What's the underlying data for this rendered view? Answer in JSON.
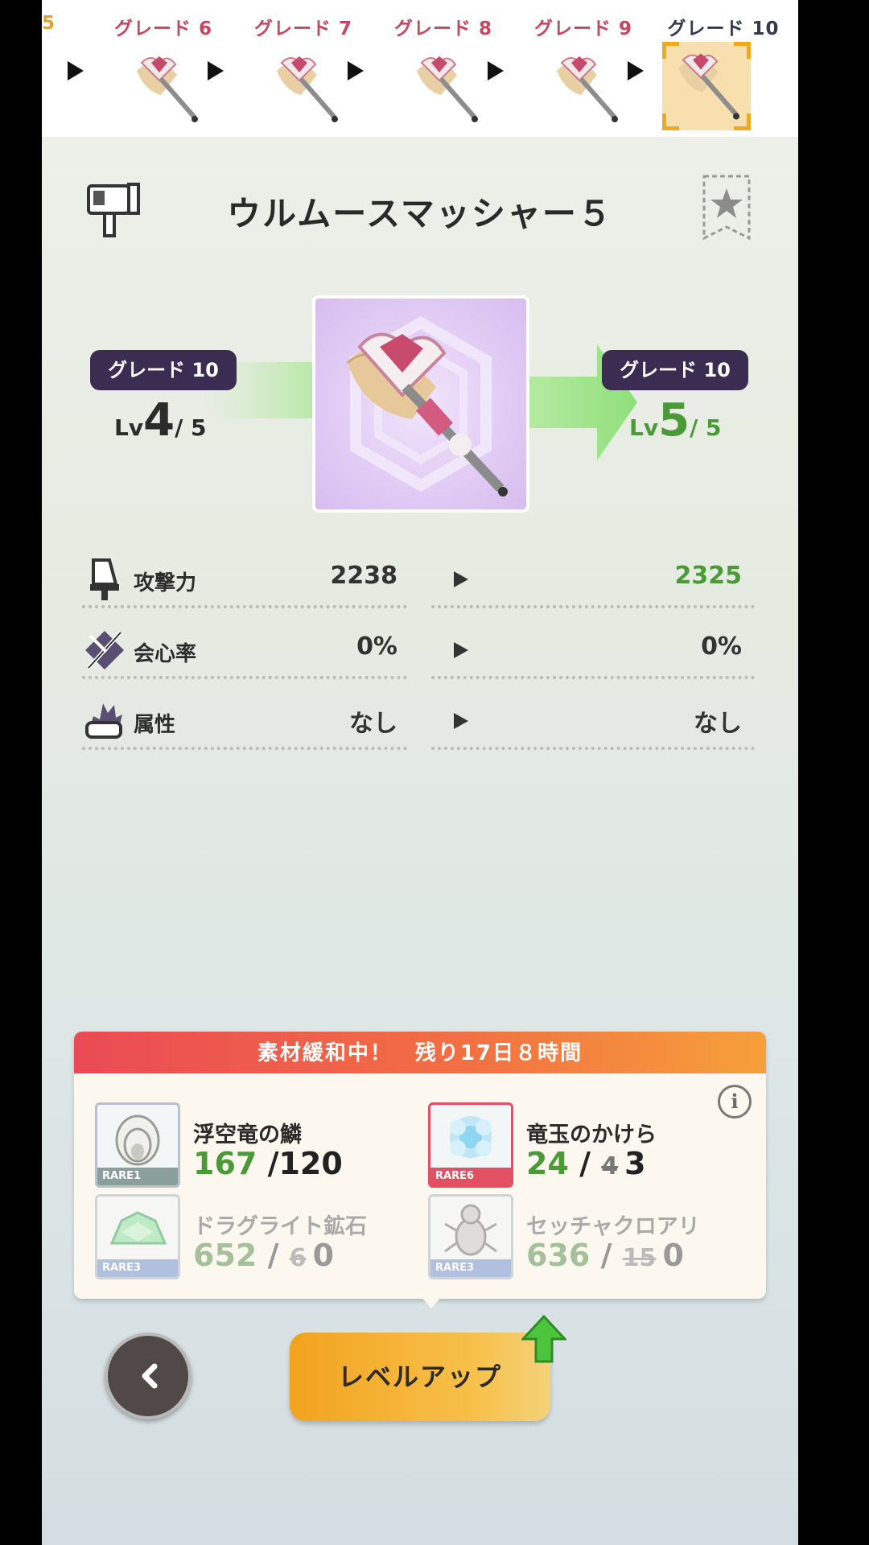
{
  "grade_strip": {
    "partial_label": "5",
    "items": [
      {
        "label": "グレード 6"
      },
      {
        "label": "グレード 7"
      },
      {
        "label": "グレード 8"
      },
      {
        "label": "グレード 9"
      },
      {
        "label": "グレード 10",
        "selected": true
      }
    ]
  },
  "weapon": {
    "name": "ウルムースマッシャー５"
  },
  "level": {
    "current": {
      "grade": "グレード 10",
      "lv_prefix": "Lv",
      "lv": "4",
      "lv_max": "/ 5"
    },
    "next": {
      "grade": "グレード 10",
      "lv_prefix": "Lv",
      "lv": "5",
      "lv_max": "/ 5"
    }
  },
  "stats": [
    {
      "label": "攻撃力",
      "current": "2238",
      "next": "2325",
      "icon": "sword-icon"
    },
    {
      "label": "会心率",
      "current": "0%",
      "next": "0%",
      "icon": "crit-icon"
    },
    {
      "label": "属性",
      "current": "なし",
      "next": "なし",
      "icon": "element-icon"
    }
  ],
  "materials": {
    "banner": "素材緩和中！　残り17日８時間",
    "items": [
      {
        "name": "浮空竜の鱗",
        "rarity": "RARE1",
        "have": "167",
        "sep": "/",
        "old": "",
        "need": "120",
        "dim": false
      },
      {
        "name": "竜玉のかけら",
        "rarity": "RARE6",
        "have": "24",
        "sep": "/",
        "old": "4",
        "need": "3",
        "dim": false
      },
      {
        "name": "ドラグライト鉱石",
        "rarity": "RARE3",
        "have": "652",
        "sep": "/",
        "old": "6",
        "need": "0",
        "dim": true
      },
      {
        "name": "セッチャクロアリ",
        "rarity": "RARE3",
        "have": "636",
        "sep": "/",
        "old": "15",
        "need": "0",
        "dim": true
      }
    ]
  },
  "buttons": {
    "back": "‹",
    "levelup": "レベルアップ",
    "info": "i"
  },
  "colors": {
    "accent_green": "#4a9a38",
    "grade_pill": "#3b2d52",
    "grade_label": "#c2485f",
    "banner_start": "#ea4a55",
    "banner_end": "#f6a03a"
  }
}
